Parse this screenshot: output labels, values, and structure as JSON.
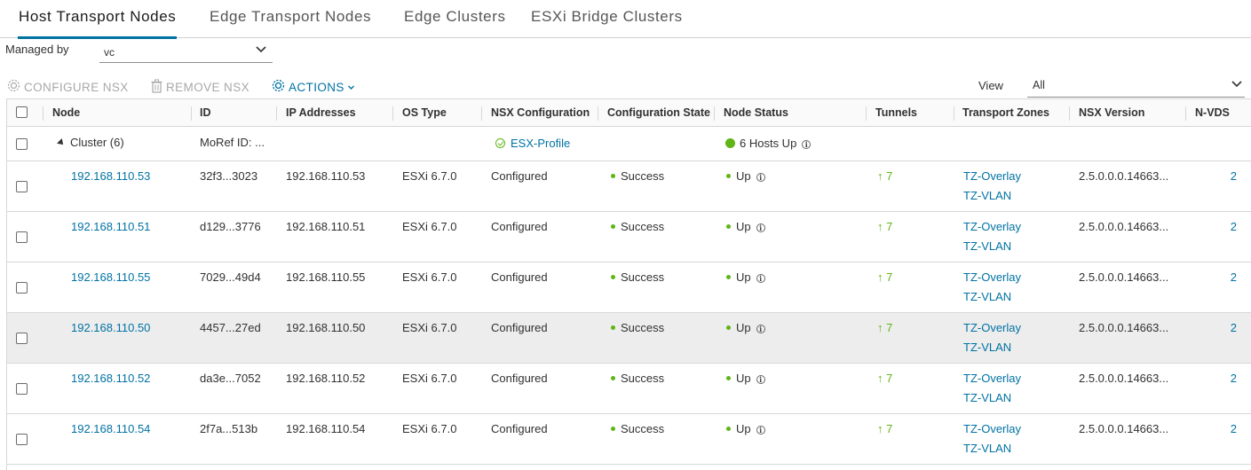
{
  "tabs": [
    {
      "label": "Host Transport Nodes",
      "active": true
    },
    {
      "label": "Edge Transport Nodes",
      "active": false
    },
    {
      "label": "Edge Clusters",
      "active": false
    },
    {
      "label": "ESXi Bridge Clusters",
      "active": false
    }
  ],
  "filter": {
    "managed_by_label": "Managed by",
    "managed_by_value": "vc",
    "view_label": "View",
    "view_value": "All"
  },
  "toolbar": {
    "configure_label": "CONFIGURE NSX",
    "remove_label": "REMOVE NSX",
    "actions_label": "ACTIONS"
  },
  "columns": [
    "Node",
    "ID",
    "IP Addresses",
    "OS Type",
    "NSX Configuration",
    "Configuration State",
    "Node Status",
    "Tunnels",
    "Transport Zones",
    "NSX Version",
    "N-VDS"
  ],
  "cluster": {
    "name": "Cluster (6)",
    "id": "MoRef ID: ...",
    "profile": "ESX-Profile",
    "status": "6 Hosts Up"
  },
  "hosts": [
    {
      "node": "192.168.110.53",
      "id": "32f3...3023",
      "ip": "192.168.110.53",
      "os": "ESXi 6.7.0",
      "nsx_config": "Configured",
      "config_state": "Success",
      "status": "Up",
      "tunnels": "7",
      "zones": [
        "TZ-Overlay",
        "TZ-VLAN"
      ],
      "version": "2.5.0.0.0.14663...",
      "nvds": "2",
      "highlighted": false
    },
    {
      "node": "192.168.110.51",
      "id": "d129...3776",
      "ip": "192.168.110.51",
      "os": "ESXi 6.7.0",
      "nsx_config": "Configured",
      "config_state": "Success",
      "status": "Up",
      "tunnels": "7",
      "zones": [
        "TZ-Overlay",
        "TZ-VLAN"
      ],
      "version": "2.5.0.0.0.14663...",
      "nvds": "2",
      "highlighted": false
    },
    {
      "node": "192.168.110.55",
      "id": "7029...49d4",
      "ip": "192.168.110.55",
      "os": "ESXi 6.7.0",
      "nsx_config": "Configured",
      "config_state": "Success",
      "status": "Up",
      "tunnels": "7",
      "zones": [
        "TZ-Overlay",
        "TZ-VLAN"
      ],
      "version": "2.5.0.0.0.14663...",
      "nvds": "2",
      "highlighted": false
    },
    {
      "node": "192.168.110.50",
      "id": "4457...27ed",
      "ip": "192.168.110.50",
      "os": "ESXi 6.7.0",
      "nsx_config": "Configured",
      "config_state": "Success",
      "status": "Up",
      "tunnels": "7",
      "zones": [
        "TZ-Overlay",
        "TZ-VLAN"
      ],
      "version": "2.5.0.0.0.14663...",
      "nvds": "2",
      "highlighted": true
    },
    {
      "node": "192.168.110.52",
      "id": "da3e...7052",
      "ip": "192.168.110.52",
      "os": "ESXi 6.7.0",
      "nsx_config": "Configured",
      "config_state": "Success",
      "status": "Up",
      "tunnels": "7",
      "zones": [
        "TZ-Overlay",
        "TZ-VLAN"
      ],
      "version": "2.5.0.0.0.14663...",
      "nvds": "2",
      "highlighted": false
    },
    {
      "node": "192.168.110.54",
      "id": "2f7a...513b",
      "ip": "192.168.110.54",
      "os": "ESXi 6.7.0",
      "nsx_config": "Configured",
      "config_state": "Success",
      "status": "Up",
      "tunnels": "7",
      "zones": [
        "TZ-Overlay",
        "TZ-VLAN"
      ],
      "version": "2.5.0.0.0.14663...",
      "nvds": "2",
      "highlighted": false
    }
  ],
  "colors": {
    "accent": "#0072a3",
    "success": "#60b515",
    "row_highlight": "#ededed"
  },
  "icons": {
    "configure": "gear-icon",
    "remove": "trash-icon",
    "actions": "gear-icon",
    "dropdown": "chevron-down-icon",
    "info": "info-icon",
    "tunnel": "arrow-up-icon",
    "profile_ok": "check-circle-icon"
  }
}
